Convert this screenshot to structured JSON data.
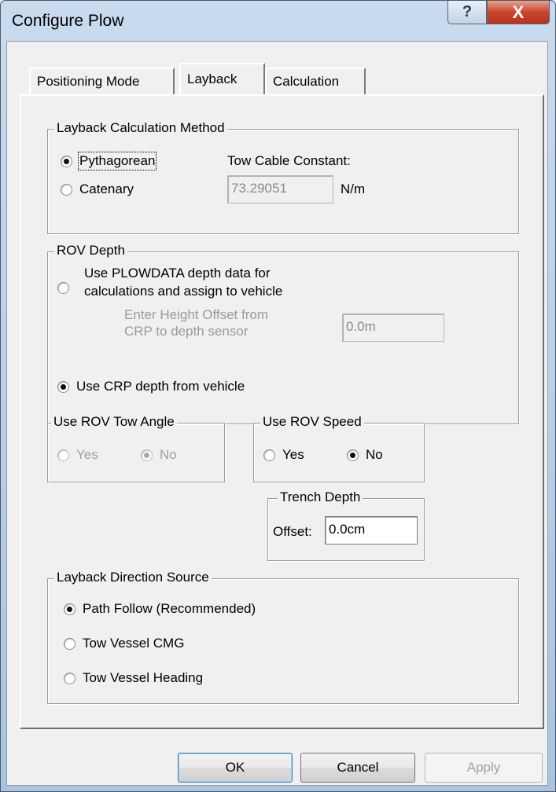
{
  "window": {
    "title": "Configure Plow",
    "help_symbol": "?",
    "close_symbol": "X"
  },
  "tabs": [
    {
      "label": "Positioning Mode",
      "active": false
    },
    {
      "label": "Layback",
      "active": true
    },
    {
      "label": "Calculation",
      "active": false
    }
  ],
  "layback_method": {
    "legend": "Layback Calculation Method",
    "option_pythagorean": "Pythagorean",
    "option_catenary": "Catenary",
    "selected": "Pythagorean",
    "constant_label": "Tow Cable Constant:",
    "constant_value": "73.29051",
    "constant_unit": "N/m"
  },
  "rov_depth": {
    "legend": "ROV Depth",
    "option_plowdata_line1": "Use PLOWDATA depth data for",
    "option_plowdata_line2": "calculations and assign to vehicle",
    "offset_label_line1": "Enter Height Offset from",
    "offset_label_line2": "CRP to depth sensor",
    "offset_value": "0.0m",
    "option_crp": "Use CRP depth from vehicle",
    "selected": "Use CRP depth from vehicle"
  },
  "tow_angle": {
    "legend": "Use ROV Tow Angle",
    "yes": "Yes",
    "no": "No",
    "selected": "No",
    "enabled": false
  },
  "rov_speed": {
    "legend": "Use ROV Speed",
    "yes": "Yes",
    "no": "No",
    "selected": "No",
    "enabled": true
  },
  "trench_depth": {
    "legend": "Trench Depth",
    "offset_label": "Offset:",
    "offset_value": "0.0cm"
  },
  "direction_source": {
    "legend": "Layback Direction Source",
    "options": [
      "Path Follow (Recommended)",
      "Tow Vessel CMG",
      "Tow Vessel Heading"
    ],
    "selected": "Path Follow (Recommended)"
  },
  "buttons": {
    "ok": "OK",
    "cancel": "Cancel",
    "apply": "Apply"
  }
}
